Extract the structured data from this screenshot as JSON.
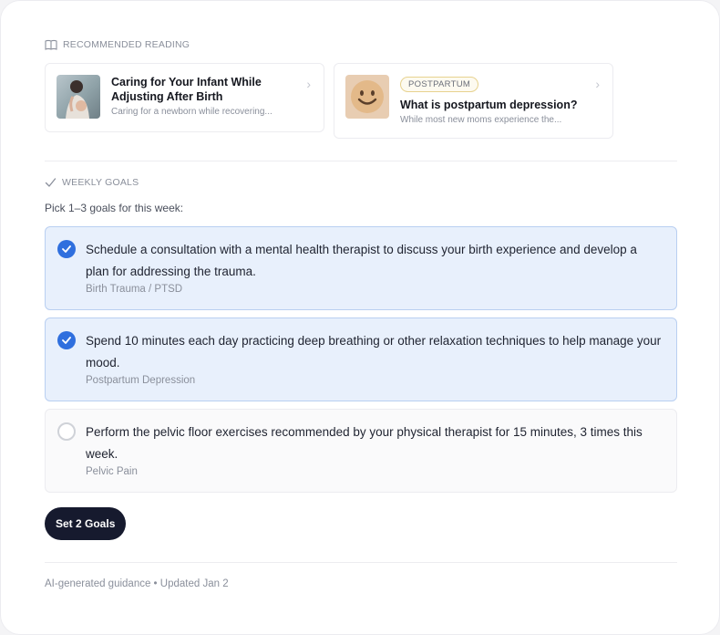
{
  "reading": {
    "heading": "RECOMMENDED READING",
    "icon": "book-icon",
    "articles": [
      {
        "title": "Caring for Your Infant While Adjusting After Birth",
        "summary": "Caring for a newborn while recovering...",
        "thumb": "mother-infant-photo"
      },
      {
        "tag": "POSTPARTUM",
        "title": "What is postpartum depression?",
        "summary": "While most new moms experience the...",
        "thumb": "smiley-face-image"
      }
    ]
  },
  "goals": {
    "heading": "WEEKLY GOALS",
    "icon": "check-icon",
    "prompt": "Pick 1–3 goals for this week:",
    "items": [
      {
        "text": "Schedule a consultation with a mental health therapist to discuss your birth experience and develop a plan for addressing the trauma.",
        "category": "Birth Trauma / PTSD",
        "selected": true
      },
      {
        "text": "Spend 10 minutes each day practicing deep breathing or other relaxation techniques to help manage your mood.",
        "category": "Postpartum Depression",
        "selected": true
      },
      {
        "text": "Perform the pelvic floor exercises recommended by your physical therapist for 15 minutes, 3 times this week.",
        "category": "Pelvic Pain",
        "selected": false
      }
    ],
    "button_label": "Set 2 Goals"
  },
  "footer": "AI-generated guidance • Updated Jan 2",
  "colors": {
    "accent": "#2f6fde",
    "selected_bg": "#e8f0fc",
    "button": "#161a2e"
  }
}
